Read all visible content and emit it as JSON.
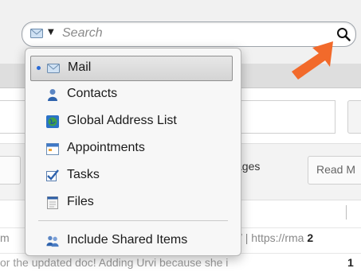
{
  "search": {
    "placeholder": "Search",
    "scope_icon": "envelope-icon",
    "button_icon": "magnifier-icon"
  },
  "menu": {
    "items": [
      {
        "label": "Mail",
        "icon": "envelope-icon",
        "selected": true
      },
      {
        "label": "Contacts",
        "icon": "person-icon",
        "selected": false
      },
      {
        "label": "Global Address List",
        "icon": "globe-icon",
        "selected": false
      },
      {
        "label": "Appointments",
        "icon": "calendar-icon",
        "selected": false
      },
      {
        "label": "Tasks",
        "icon": "checkbox-icon",
        "selected": false
      },
      {
        "label": "Files",
        "icon": "document-icon",
        "selected": false
      }
    ],
    "shared": {
      "label": "Include Shared Items",
      "icon": "people-icon"
    }
  },
  "background": {
    "tab_messages": "ssages",
    "tab_read": "Read M",
    "row1_left": "m",
    "row1_right": "/ | https://rma",
    "row1_num": "2",
    "row2_text": "or the updated doc! Adding Urvi because she i",
    "row2_num": "1"
  },
  "annotation": {
    "arrow_color": "#f26a2b"
  }
}
